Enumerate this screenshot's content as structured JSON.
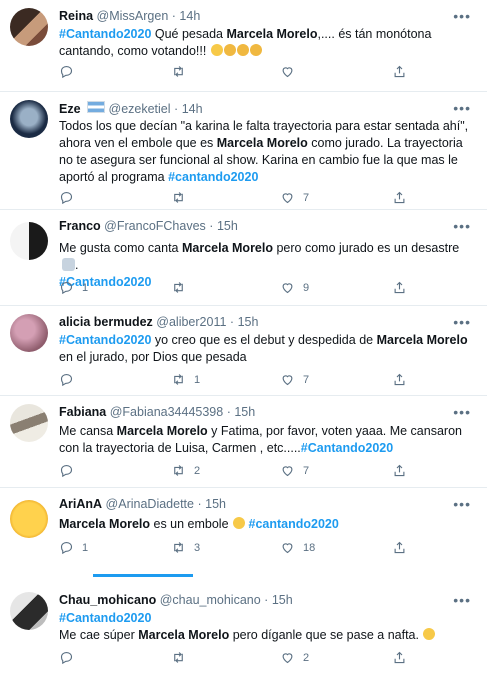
{
  "tweets": [
    {
      "name": "Reina",
      "handle": "@MissArgen",
      "time": "14h",
      "segments": [
        {
          "t": "tag",
          "v": "#Cantando2020"
        },
        {
          "t": "text",
          "v": " Qué pesada "
        },
        {
          "t": "bold",
          "v": "Marcela Morelo"
        },
        {
          "t": "text",
          "v": ",.... és tán monótona cantando, como votando!!! "
        }
      ],
      "emojis": [
        "face-rolling-eyes",
        "confounded-face",
        "confounded-face",
        "confounded-face"
      ],
      "reply": "",
      "retweet": "",
      "like": ""
    },
    {
      "name": "Eze",
      "handle": "@ezeketiel",
      "time": "14h",
      "flag": "argentina-flag",
      "segments": [
        {
          "t": "text",
          "v": "Todos los que decían \"a karina le falta trayectoria para estar sentada ahí\", ahora ven el embole que es "
        },
        {
          "t": "bold",
          "v": "Marcela Morelo"
        },
        {
          "t": "text",
          "v": " como jurado. La trayectoria no te asegura ser funcional al show. Karina en cambio fue la que mas le aportó al programa "
        },
        {
          "t": "tag",
          "v": "#cantando2020"
        }
      ],
      "reply": "",
      "retweet": "",
      "like": "7"
    },
    {
      "name": "Franco",
      "handle": "@FrancoFChaves",
      "time": "15h",
      "segments": [
        {
          "t": "text",
          "v": "Me gusta como canta "
        },
        {
          "t": "bold",
          "v": "Marcela Morelo"
        },
        {
          "t": "text",
          "v": " pero como jurado es un desastre "
        },
        {
          "t": "emoji",
          "v": "facepalm"
        },
        {
          "t": "text",
          "v": "."
        },
        {
          "t": "br",
          "v": ""
        },
        {
          "t": "tag",
          "v": "#Cantando2020"
        }
      ],
      "reply": "1",
      "retweet": "",
      "like": "9"
    },
    {
      "name": "alicia bermudez",
      "handle": "@aliber2011",
      "time": "15h",
      "segments": [
        {
          "t": "tag",
          "v": "#Cantando2020"
        },
        {
          "t": "text",
          "v": " yo creo que es el debut y despedida de "
        },
        {
          "t": "bold",
          "v": "Marcela Morelo"
        },
        {
          "t": "text",
          "v": " en el jurado, por Dios que pesada"
        }
      ],
      "reply": "",
      "retweet": "1",
      "like": "7"
    },
    {
      "name": "Fabiana",
      "handle": "@Fabiana34445398",
      "time": "15h",
      "segments": [
        {
          "t": "text",
          "v": "Me cansa "
        },
        {
          "t": "bold",
          "v": "Marcela Morelo"
        },
        {
          "t": "text",
          "v": " y Fatima, por favor, voten yaaa. Me cansaron con la trayectoria de Luisa, Carmen , etc....."
        },
        {
          "t": "tag",
          "v": "#Cantando2020"
        }
      ],
      "reply": "",
      "retweet": "2",
      "like": "7"
    },
    {
      "name": "AriAnA",
      "handle": "@ArinaDiadette",
      "time": "15h",
      "segments": [
        {
          "t": "bold",
          "v": "Marcela Morelo"
        },
        {
          "t": "text",
          "v": " es un embole "
        },
        {
          "t": "emoji",
          "v": "face-rolling-eyes"
        },
        {
          "t": "text",
          "v": " "
        },
        {
          "t": "tag",
          "v": "#cantando2020"
        }
      ],
      "reply": "1",
      "retweet": "3",
      "like": "18"
    },
    {
      "name": "Chau_mohicano",
      "handle": "@chau_mohicano",
      "time": "15h",
      "segments": [
        {
          "t": "tag",
          "v": "#Cantando2020"
        },
        {
          "t": "br",
          "v": ""
        },
        {
          "t": "text",
          "v": "Me cae súper "
        },
        {
          "t": "bold",
          "v": "Marcela Morelo"
        },
        {
          "t": "text",
          "v": " pero díganle que se pase a nafta. "
        },
        {
          "t": "emoji",
          "v": "grimacing-face"
        }
      ],
      "reply": "",
      "retweet": "",
      "like": "2"
    }
  ],
  "colors": {
    "accent": "#1d9bf0",
    "muted": "#5b7083",
    "text": "#0f1419"
  }
}
